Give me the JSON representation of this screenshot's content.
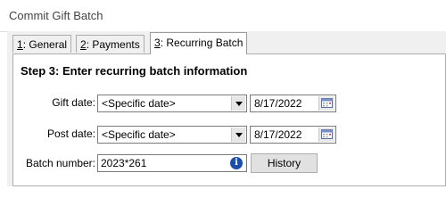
{
  "window": {
    "title": "Commit Gift Batch"
  },
  "tabs": [
    {
      "label_key": "1",
      "label_rest": ": General"
    },
    {
      "label_key": "2",
      "label_rest": ": Payments"
    },
    {
      "label_key": "3",
      "label_rest": ": Recurring Batch"
    }
  ],
  "active_tab": "3: Recurring Batch",
  "step": {
    "heading": "Step 3:  Enter recurring batch information"
  },
  "gift_date": {
    "label": "Gift date:",
    "option": "<Specific date>",
    "date": "8/17/2022"
  },
  "post_date": {
    "label": "Post date:",
    "option": "<Specific date>",
    "date": "8/17/2022"
  },
  "batch_number": {
    "label": "Batch number:",
    "value": "2023*261"
  },
  "history_button": {
    "label": "History"
  },
  "icons": {
    "dropdown": "chevron-down-icon",
    "calendar": "calendar-icon",
    "info": "info-icon"
  },
  "colors": {
    "info_icon": "#1b4fa8",
    "panel_bg": "#f0f0f0"
  }
}
